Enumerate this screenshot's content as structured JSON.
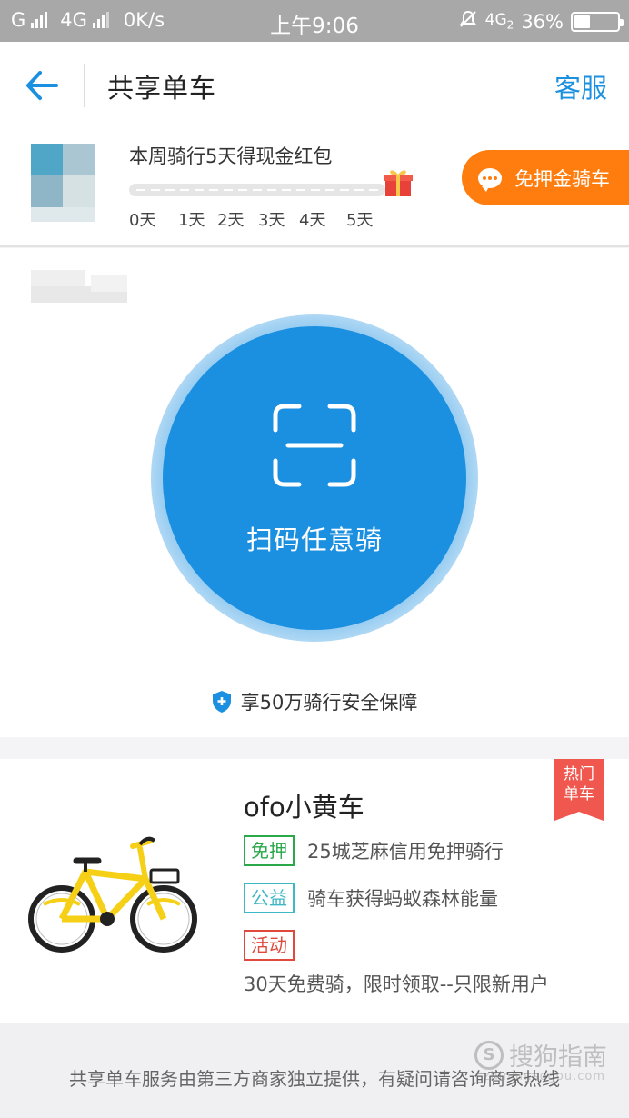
{
  "status_bar": {
    "carrier1": "G",
    "carrier2": "4G",
    "speed": "0K/s",
    "time": "上午9:06",
    "network": "4G",
    "network_sub": "2",
    "battery_text": "36%",
    "battery_level": 0.36
  },
  "nav": {
    "title": "共享单车",
    "service": "客服"
  },
  "weekly": {
    "title": "本周骑行5天得现金红包",
    "days": [
      "0天",
      "1天",
      "2天",
      "3天",
      "4天",
      "5天"
    ],
    "free_deposit_button": "免押金骑车"
  },
  "scan": {
    "label": "扫码任意骑",
    "insurance": "享50万骑行安全保障"
  },
  "card": {
    "hot_badge_line1": "热门",
    "hot_badge_line2": "单车",
    "title": "ofo小黄车",
    "rows": [
      {
        "tag": "免押",
        "text": "25城芝麻信用免押骑行"
      },
      {
        "tag": "公益",
        "text": "骑车获得蚂蚁森林能量"
      },
      {
        "tag": "活动",
        "text": ""
      }
    ],
    "activity_text": "30天免费骑，限时领取--只限新用户"
  },
  "footer": {
    "text": "共享单车服务由第三方商家独立提供，有疑问请咨询商家热线",
    "watermark": "搜狗指南",
    "watermark_sub": "zhinan.sogou.com"
  },
  "colors": {
    "accent": "#1b8fe0",
    "orange": "#ff7d0f",
    "tag_green": "#2aa84a",
    "tag_teal": "#3fb8c6",
    "tag_red": "#e0493e",
    "hot_badge": "#f0574f"
  },
  "icons": [
    "back-arrow-icon",
    "gift-icon",
    "chat-icon",
    "scan-icon",
    "shield-icon",
    "bicycle-image",
    "battery-icon"
  ]
}
